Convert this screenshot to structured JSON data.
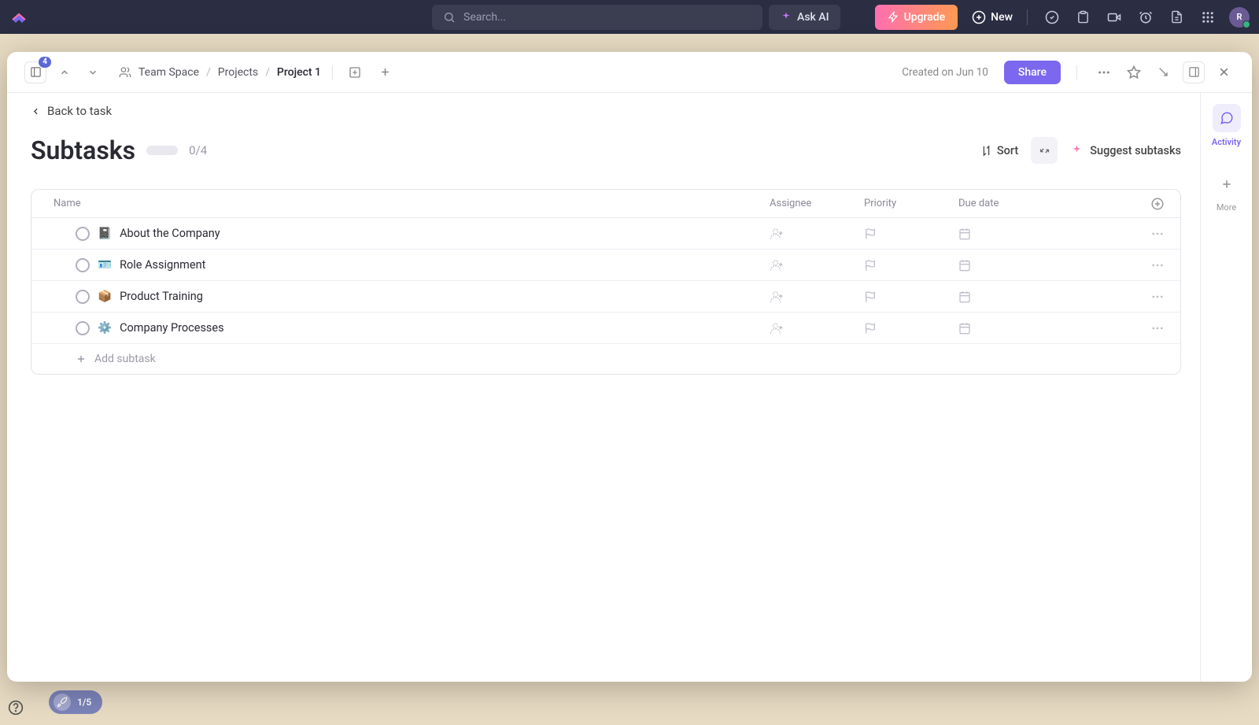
{
  "topbar": {
    "search_placeholder": "Search...",
    "ask_ai": "Ask AI",
    "upgrade": "Upgrade",
    "new": "New",
    "avatar_letter": "R"
  },
  "modal_header": {
    "badge": "4",
    "breadcrumb": {
      "space": "Team Space",
      "folder": "Projects",
      "task": "Project 1"
    },
    "created_on": "Created on Jun 10",
    "share": "Share"
  },
  "back_link": "Back to task",
  "title": "Subtasks",
  "subtask_count": "0/4",
  "actions": {
    "sort": "Sort",
    "suggest": "Suggest subtasks"
  },
  "columns": {
    "name": "Name",
    "assignee": "Assignee",
    "priority": "Priority",
    "due_date": "Due date"
  },
  "rows": [
    {
      "emoji": "📓",
      "name": "About the Company"
    },
    {
      "emoji": "🪪",
      "name": "Role Assignment"
    },
    {
      "emoji": "📦",
      "name": "Product Training"
    },
    {
      "emoji": "⚙️",
      "name": "Company Processes"
    }
  ],
  "add_subtask": "Add subtask",
  "rail": {
    "activity": "Activity",
    "more": "More"
  },
  "onboarding": "1/5"
}
